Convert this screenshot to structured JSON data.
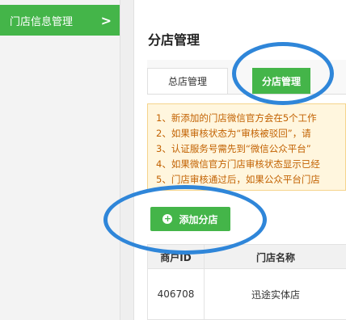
{
  "sidebar": {
    "items": [
      {
        "label": "门店信息管理",
        "chevron": ">"
      }
    ]
  },
  "main": {
    "page_title": "分店管理",
    "tabs": [
      {
        "label": "总店管理"
      },
      {
        "label": "分店管理"
      }
    ],
    "notice_lines": [
      "1、新添加的门店微信官方会在5个工作",
      "2、如果审核状态为“审核被驳回”，请",
      "3、认证服务号需先到“微信公众平台”",
      "4、如果微信官方门店审核状态显示已经",
      "5、门店审核通过后，如果公众平台门店"
    ],
    "add_button_label": "添加分店",
    "table": {
      "headers": [
        "商户ID",
        "门店名称"
      ],
      "rows": [
        [
          "406708",
          "迅途实体店"
        ]
      ]
    }
  },
  "colors": {
    "accent_green": "#44b549",
    "highlight_blue": "#2f86d9",
    "notice_text": "#c26100",
    "notice_bg": "#fff6de"
  }
}
